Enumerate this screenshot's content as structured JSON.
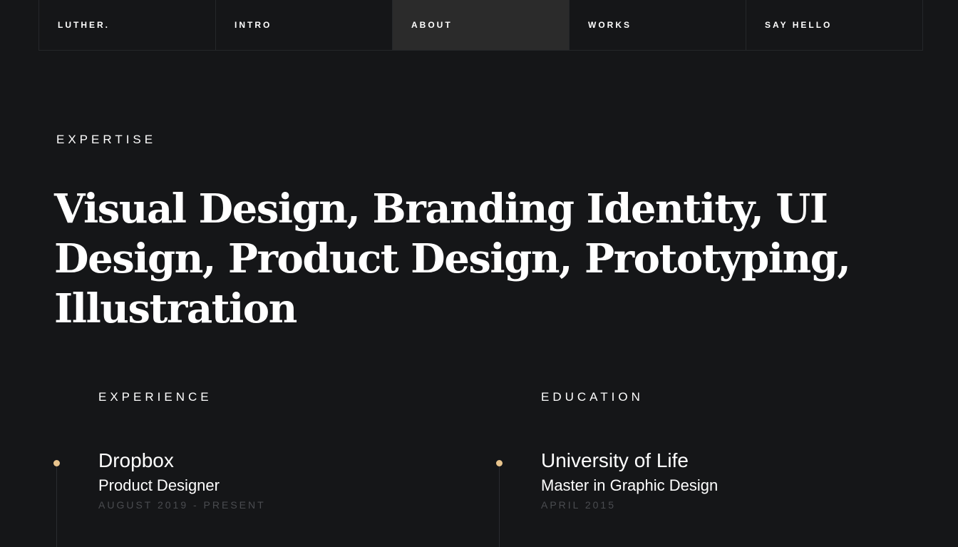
{
  "nav": {
    "items": [
      {
        "label": "LUTHER."
      },
      {
        "label": "INTRO"
      },
      {
        "label": "ABOUT"
      },
      {
        "label": "WORKS"
      },
      {
        "label": "SAY HELLO"
      }
    ],
    "active": "ABOUT"
  },
  "expertise": {
    "label": "EXPERTISE",
    "headline": "Visual Design, Branding Identity, UI Design, Product Design, Prototyping, Illustration"
  },
  "experience": {
    "label": "EXPERIENCE",
    "items": [
      {
        "company": "Dropbox",
        "role": "Product Designer",
        "date": "AUGUST 2019 - PRESENT"
      }
    ]
  },
  "education": {
    "label": "EDUCATION",
    "items": [
      {
        "school": "University of Life",
        "degree": "Master in Graphic Design",
        "date": "APRIL 2015"
      }
    ]
  },
  "colors": {
    "background": "#151618",
    "accent_dot": "#e8c48d",
    "nav_active": "#2b2b2b",
    "muted_text": "#4a4c50"
  }
}
